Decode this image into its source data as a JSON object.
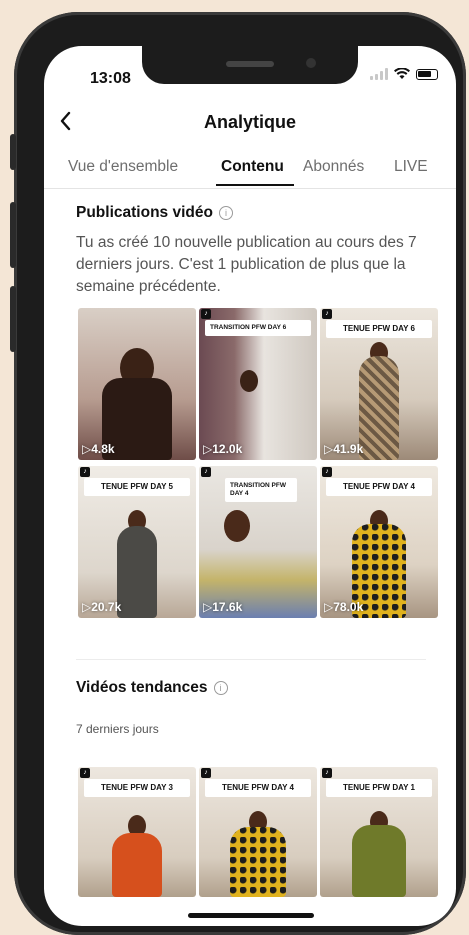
{
  "status": {
    "time": "13:08"
  },
  "header": {
    "title": "Analytique"
  },
  "tabs": [
    "Vue d'ensemble",
    "Contenu",
    "Abonnés",
    "LIVE"
  ],
  "publications": {
    "title": "Publications vidéo",
    "description": "Tu as créé 10 nouvelle publication au cours des 7 derniers jours. C'est 1 publication de plus que la semaine précédente.",
    "videos": [
      {
        "label": "",
        "views": "4.8k"
      },
      {
        "label": "TRANSITION PFW DAY 6",
        "views": "12.0k"
      },
      {
        "label": "TENUE PFW DAY 6",
        "views": "41.9k"
      },
      {
        "label": "TENUE PFW DAY 5",
        "views": "20.7k"
      },
      {
        "label": "TRANSITION PFW DAY 4",
        "views": "17.6k"
      },
      {
        "label": "TENUE PFW DAY 4",
        "views": "78.0k"
      }
    ]
  },
  "trending": {
    "title": "Vidéos tendances",
    "period": "7 derniers jours",
    "videos": [
      {
        "label": "TENUE PFW DAY 3"
      },
      {
        "label": "TENUE PFW DAY 4"
      },
      {
        "label": "TENUE PFW DAY 1"
      }
    ]
  },
  "colors": {
    "background": "#f4e6d6",
    "phone_frame": "#1c1c1c",
    "text": "#111111",
    "muted": "#555555"
  },
  "icons": {
    "back": "chevron-left-icon",
    "info": "info-icon",
    "play": "play-icon",
    "tiktok": "tiktok-icon"
  }
}
